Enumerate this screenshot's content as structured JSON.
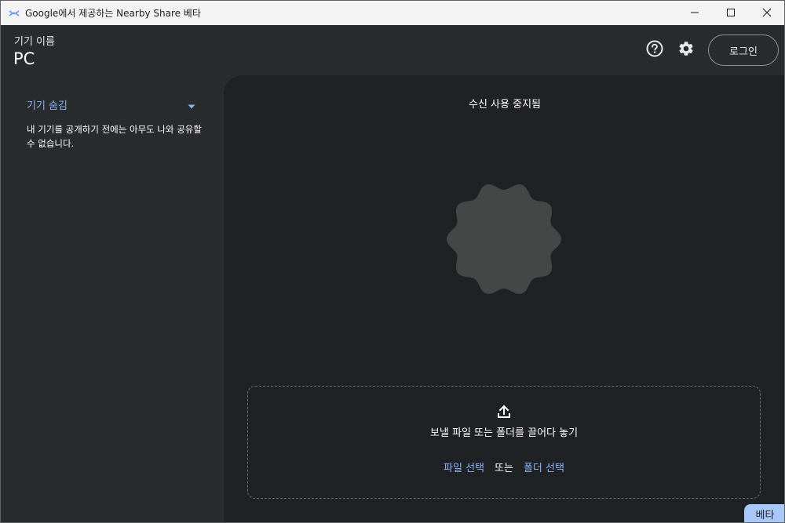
{
  "window": {
    "title": "Google에서 제공하는 Nearby Share 베타",
    "app_icon": "nearby-share-icon",
    "controls": [
      "minimize-icon",
      "maximize-icon",
      "close-icon"
    ]
  },
  "header": {
    "device_caption": "기기 이름",
    "device_name": "PC",
    "help_icon": "help-circle-icon",
    "settings_icon": "gear-icon",
    "login_label": "로그인"
  },
  "sidebar": {
    "visibility_label": "기기 숨김",
    "visibility_description": "내 기기를 공개하기 전에는 아무도 나와 공유할 수 없습니다."
  },
  "main": {
    "status": "수신 사용 중지됨",
    "dropzone": {
      "icon": "upload-icon",
      "text": "보낼 파일 또는 폴더를 끌어다 놓기",
      "select_files": "파일 선택",
      "or": "또는",
      "select_folder": "폴더 선택"
    }
  },
  "badge": "베타",
  "colors": {
    "accent": "#8ab4f8",
    "background": "#202124",
    "panel": "#2a2b2d",
    "blob": "#444746",
    "badge": "#a8c7fa"
  }
}
